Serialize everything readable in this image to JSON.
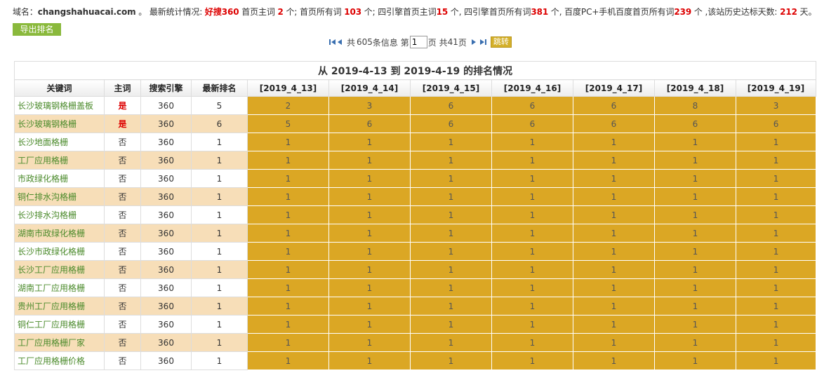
{
  "stats": {
    "domain_label": "域名：",
    "domain": "changshahuacai.com",
    "sep": " 。",
    "latest_label": " 最新统计情况: ",
    "engine_name": "好搜360",
    "homepage_main_label": " 首页主词 ",
    "homepage_main_count": "2",
    "homepage_all_label": " 个; 首页所有词 ",
    "homepage_all_count": "103",
    "four_main_label": " 个; 四引擎首页主词",
    "four_main_count": "15",
    "four_all_label": " 个, 四引擎首页所有词",
    "four_all_count": "381",
    "baidu_label": " 个, 百度PC+手机百度首页所有词",
    "baidu_count": "239",
    "days_label": " 个 ,该站历史达标天数: ",
    "days_count": "212",
    "days_unit": " 天。"
  },
  "export_button": "导出排名",
  "pager": {
    "total_prefix": "共 ",
    "total_count": "605",
    "total_suffix": " 条信息 第",
    "current_page": "1",
    "pages_prefix": "页 共 ",
    "total_pages": "41",
    "pages_suffix": " 页",
    "jump_label": "跳转"
  },
  "table": {
    "caption": "从 2019-4-13 到 2019-4-19 的排名情况",
    "headers": {
      "keyword": "关键词",
      "main": "主词",
      "engine": "搜索引擎",
      "latest": "最新排名",
      "d1": "[2019_4_13]",
      "d2": "[2019_4_14]",
      "d3": "[2019_4_15]",
      "d4": "[2019_4_16]",
      "d5": "[2019_4_17]",
      "d6": "[2019_4_18]",
      "d7": "[2019_4_19]"
    },
    "rows": [
      {
        "keyword": "长沙玻璃钢格栅盖板",
        "main": "是",
        "engine": "360",
        "latest": "5",
        "d1": "2",
        "d2": "3",
        "d3": "6",
        "d4": "6",
        "d5": "6",
        "d6": "8",
        "d7": "3"
      },
      {
        "keyword": "长沙玻璃钢格栅",
        "main": "是",
        "engine": "360",
        "latest": "6",
        "d1": "5",
        "d2": "6",
        "d3": "6",
        "d4": "6",
        "d5": "6",
        "d6": "6",
        "d7": "6"
      },
      {
        "keyword": "长沙地面格栅",
        "main": "否",
        "engine": "360",
        "latest": "1",
        "d1": "1",
        "d2": "1",
        "d3": "1",
        "d4": "1",
        "d5": "1",
        "d6": "1",
        "d7": "1"
      },
      {
        "keyword": "工厂应用格栅",
        "main": "否",
        "engine": "360",
        "latest": "1",
        "d1": "1",
        "d2": "1",
        "d3": "1",
        "d4": "1",
        "d5": "1",
        "d6": "1",
        "d7": "1"
      },
      {
        "keyword": "市政绿化格栅",
        "main": "否",
        "engine": "360",
        "latest": "1",
        "d1": "1",
        "d2": "1",
        "d3": "1",
        "d4": "1",
        "d5": "1",
        "d6": "1",
        "d7": "1"
      },
      {
        "keyword": "铜仁排水沟格栅",
        "main": "否",
        "engine": "360",
        "latest": "1",
        "d1": "1",
        "d2": "1",
        "d3": "1",
        "d4": "1",
        "d5": "1",
        "d6": "1",
        "d7": "1"
      },
      {
        "keyword": "长沙排水沟格栅",
        "main": "否",
        "engine": "360",
        "latest": "1",
        "d1": "1",
        "d2": "1",
        "d3": "1",
        "d4": "1",
        "d5": "1",
        "d6": "1",
        "d7": "1"
      },
      {
        "keyword": "湖南市政绿化格栅",
        "main": "否",
        "engine": "360",
        "latest": "1",
        "d1": "1",
        "d2": "1",
        "d3": "1",
        "d4": "1",
        "d5": "1",
        "d6": "1",
        "d7": "1"
      },
      {
        "keyword": "长沙市政绿化格栅",
        "main": "否",
        "engine": "360",
        "latest": "1",
        "d1": "1",
        "d2": "1",
        "d3": "1",
        "d4": "1",
        "d5": "1",
        "d6": "1",
        "d7": "1"
      },
      {
        "keyword": "长沙工厂应用格栅",
        "main": "否",
        "engine": "360",
        "latest": "1",
        "d1": "1",
        "d2": "1",
        "d3": "1",
        "d4": "1",
        "d5": "1",
        "d6": "1",
        "d7": "1"
      },
      {
        "keyword": "湖南工厂应用格栅",
        "main": "否",
        "engine": "360",
        "latest": "1",
        "d1": "1",
        "d2": "1",
        "d3": "1",
        "d4": "1",
        "d5": "1",
        "d6": "1",
        "d7": "1"
      },
      {
        "keyword": "贵州工厂应用格栅",
        "main": "否",
        "engine": "360",
        "latest": "1",
        "d1": "1",
        "d2": "1",
        "d3": "1",
        "d4": "1",
        "d5": "1",
        "d6": "1",
        "d7": "1"
      },
      {
        "keyword": "铜仁工厂应用格栅",
        "main": "否",
        "engine": "360",
        "latest": "1",
        "d1": "1",
        "d2": "1",
        "d3": "1",
        "d4": "1",
        "d5": "1",
        "d6": "1",
        "d7": "1"
      },
      {
        "keyword": "工厂应用格栅厂家",
        "main": "否",
        "engine": "360",
        "latest": "1",
        "d1": "1",
        "d2": "1",
        "d3": "1",
        "d4": "1",
        "d5": "1",
        "d6": "1",
        "d7": "1"
      },
      {
        "keyword": "工厂应用格栅价格",
        "main": "否",
        "engine": "360",
        "latest": "1",
        "d1": "1",
        "d2": "1",
        "d3": "1",
        "d4": "1",
        "d5": "1",
        "d6": "1",
        "d7": "1"
      }
    ]
  },
  "colors": {
    "accent_green": "#8ab93c",
    "rank_cell": "#dba724",
    "row_alt": "#f7deb8",
    "highlight_red": "#dd0000",
    "keyword_green": "#4a8a2a"
  },
  "icons": [
    "first-page-icon",
    "prev-page-icon",
    "next-page-icon",
    "last-page-icon"
  ]
}
